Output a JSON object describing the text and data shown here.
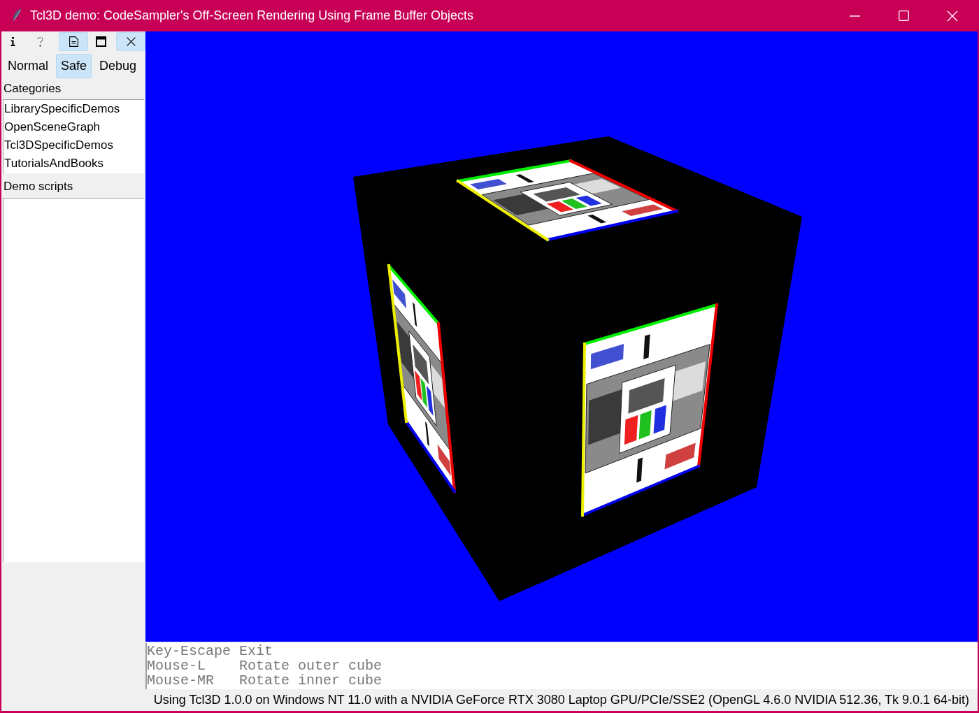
{
  "window": {
    "title": "Tcl3D demo: CodeSampler's Off-Screen Rendering Using Frame Buffer Objects"
  },
  "toolbar": [
    {
      "kind": "info",
      "selected": false
    },
    {
      "kind": "help",
      "selected": false
    },
    {
      "kind": "document",
      "selected": true
    },
    {
      "kind": "window",
      "selected": false
    },
    {
      "kind": "close",
      "selected": true
    }
  ],
  "modes": [
    {
      "label": "Normal",
      "selected": false
    },
    {
      "label": "Safe",
      "selected": true
    },
    {
      "label": "Debug",
      "selected": false
    }
  ],
  "categories": {
    "label": "Categories",
    "items": [
      {
        "label": "LibrarySpecificDemos",
        "selected": false
      },
      {
        "label": "OpenSceneGraph",
        "selected": false
      },
      {
        "label": "Tcl3DSpecificDemos",
        "selected": false
      },
      {
        "label": "TutorialsAndBooks",
        "selected": false
      }
    ]
  },
  "demo_scripts": {
    "label": "Demo scripts"
  },
  "help_text": [
    {
      "key": "Key-Escape",
      "action": "Exit"
    },
    {
      "key": "Mouse-L",
      "action": "Rotate outer cube"
    },
    {
      "key": "Mouse-MR",
      "action": "Rotate inner cube"
    }
  ],
  "status_bar": "Using Tcl3D 1.0.0 on Windows NT 11.0 with a NVIDIA GeForce RTX 3080 Laptop GPU/PCIe/SSE2 (OpenGL 4.6.0 NVIDIA 512.36, Tk 9.0.1 64-bit)"
}
